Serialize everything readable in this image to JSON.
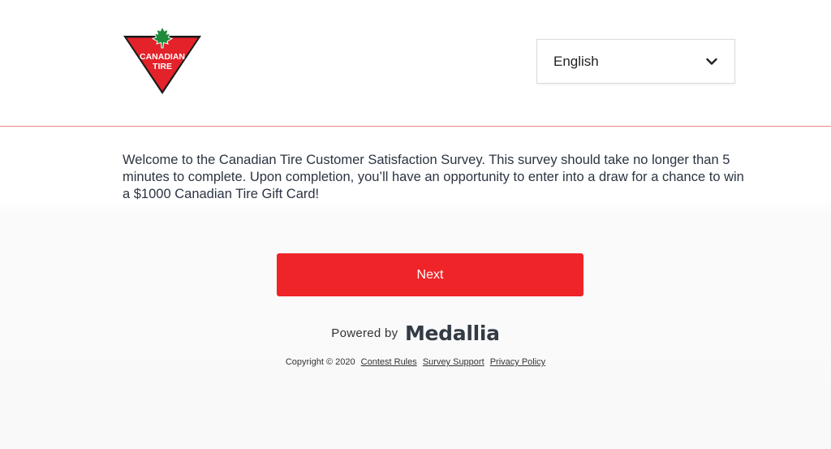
{
  "header": {
    "logo": {
      "text_line1": "CANADIAN",
      "text_line2": "TIRE",
      "colors": {
        "triangle": "#e3222a",
        "leaf": "#1e8a3c",
        "text": "#ffffff"
      }
    },
    "language_select": {
      "value": "English",
      "icon": "chevron-down-icon"
    }
  },
  "main": {
    "welcome_text": "Welcome to the Canadian Tire Customer Satisfaction Survey. This survey should take no longer than 5 minutes to complete. Upon completion, you’ll have an opportunity to enter into a draw for a chance to win a $1000 Canadian Tire Gift Card!",
    "next_button": "Next",
    "accent_color": "#ee2428"
  },
  "powered_by": {
    "label": "Powered by",
    "brand": "Medallia"
  },
  "footer": {
    "copyright": "Copyright © 2020",
    "links": [
      "Contest Rules",
      "Survey Support",
      "Privacy Policy"
    ]
  }
}
